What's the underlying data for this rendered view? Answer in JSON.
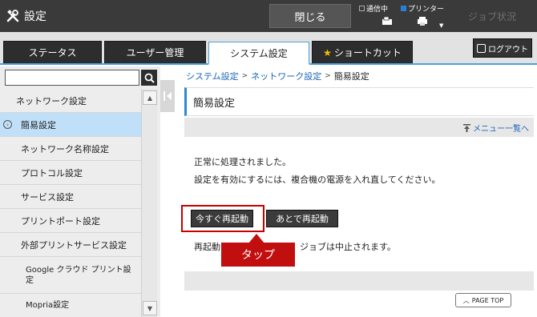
{
  "header": {
    "title": "設定",
    "close_label": "閉じる",
    "status_comm": "通信中",
    "status_printer": "プリンター",
    "job_status_label": "ジョブ状況"
  },
  "tabs": [
    {
      "label": "ステータス"
    },
    {
      "label": "ユーザー管理"
    },
    {
      "label": "システム設定"
    },
    {
      "label": "ショートカット"
    }
  ],
  "logout_label": "ログアウト",
  "search": {
    "value": "",
    "placeholder": ""
  },
  "sidebar": {
    "items": [
      {
        "label": "ネットワーク設定"
      },
      {
        "label": "簡易設定"
      },
      {
        "label": "ネットワーク名称設定"
      },
      {
        "label": "プロトコル設定"
      },
      {
        "label": "サービス設定"
      },
      {
        "label": "プリントポート設定"
      },
      {
        "label": "外部プリントサービス設定"
      },
      {
        "label": "Google クラウド プリント設定"
      },
      {
        "label": "Mopria設定"
      }
    ]
  },
  "breadcrumb": [
    "システム設定",
    "ネットワーク設定",
    "簡易設定"
  ],
  "page_title": "簡易設定",
  "menu_back_link": "メニュー一覧へ",
  "messages": {
    "line1": "正常に処理されました。",
    "line2": "設定を有効にするには、複合機の電源を入れ直してください。",
    "line3a": "再起動",
    "line3b": "ジョブは中止されます。"
  },
  "buttons": {
    "restart_now": "今すぐ再起動",
    "restart_later": "あとで再起動"
  },
  "callout_label": "タップ",
  "page_top_label": "PAGE TOP",
  "colors": {
    "accent": "#4aa0d8",
    "selected": "#bfe0f8",
    "callout": "#c10e0e"
  }
}
